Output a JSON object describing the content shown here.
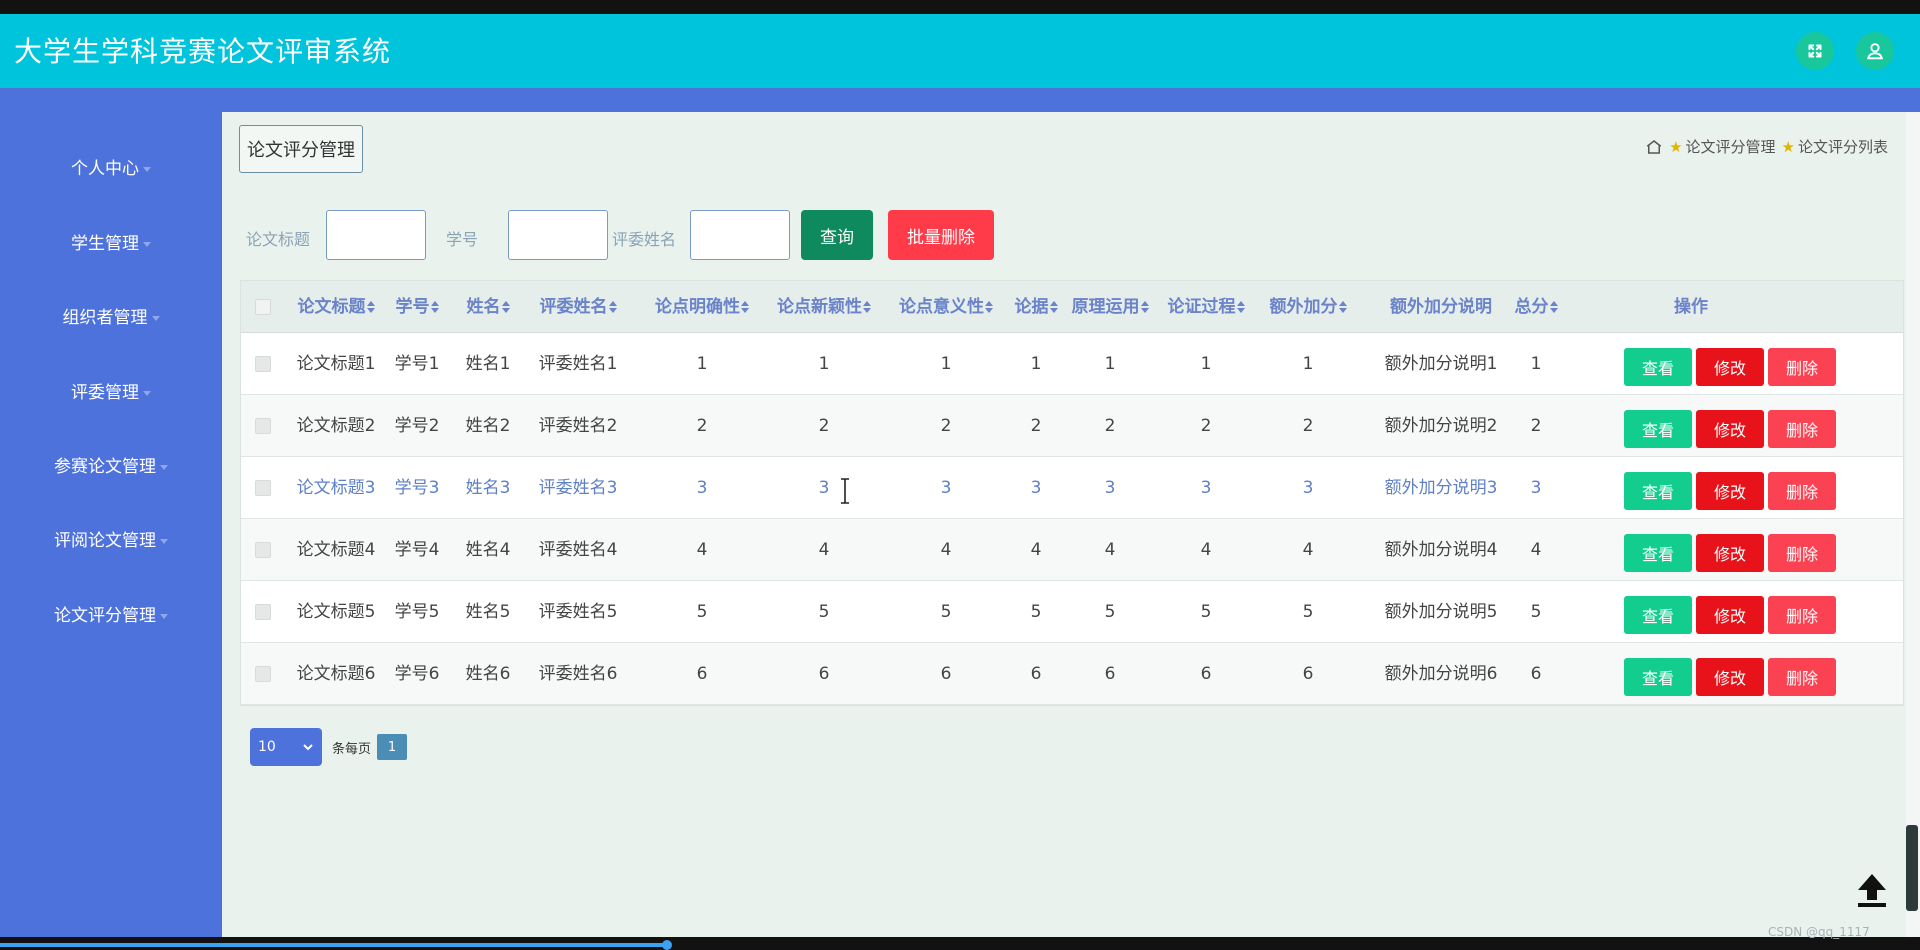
{
  "header": {
    "title": "大学生学科竞赛论文评审系统",
    "fullscreen_icon": "fullscreen-icon",
    "user_icon": "user-icon"
  },
  "sidebar": {
    "items": [
      {
        "label": "个人中心"
      },
      {
        "label": "学生管理"
      },
      {
        "label": "组织者管理"
      },
      {
        "label": "评委管理"
      },
      {
        "label": "参赛论文管理"
      },
      {
        "label": "评阅论文管理"
      },
      {
        "label": "论文评分管理"
      }
    ]
  },
  "main": {
    "section_title": "论文评分管理",
    "breadcrumb": {
      "home_icon": "home-icon",
      "item1": "论文评分管理",
      "item2": "论文评分列表"
    }
  },
  "search": {
    "label_title": "论文标题",
    "label_id": "学号",
    "label_judge": "评委姓名",
    "value_title": "",
    "value_id": "",
    "value_judge": "",
    "query_label": "查询",
    "bulk_delete_label": "批量删除"
  },
  "table": {
    "columns": {
      "title": "论文标题",
      "student_id": "学号",
      "name": "姓名",
      "judge": "评委姓名",
      "clarity": "论点明确性",
      "novelty": "论点新颖性",
      "significance": "论点意义性",
      "evidence": "论据",
      "principle": "原理运用",
      "process": "论证过程",
      "bonus": "额外加分",
      "bonus_note": "额外加分说明",
      "total": "总分",
      "actions": "操作"
    },
    "rows": [
      {
        "title": "论文标题1",
        "student_id": "学号1",
        "name": "姓名1",
        "judge": "评委姓名1",
        "clarity": "1",
        "novelty": "1",
        "significance": "1",
        "evidence": "1",
        "principle": "1",
        "process": "1",
        "bonus": "1",
        "bonus_note": "额外加分说明1",
        "total": "1"
      },
      {
        "title": "论文标题2",
        "student_id": "学号2",
        "name": "姓名2",
        "judge": "评委姓名2",
        "clarity": "2",
        "novelty": "2",
        "significance": "2",
        "evidence": "2",
        "principle": "2",
        "process": "2",
        "bonus": "2",
        "bonus_note": "额外加分说明2",
        "total": "2"
      },
      {
        "title": "论文标题3",
        "student_id": "学号3",
        "name": "姓名3",
        "judge": "评委姓名3",
        "clarity": "3",
        "novelty": "3",
        "significance": "3",
        "evidence": "3",
        "principle": "3",
        "process": "3",
        "bonus": "3",
        "bonus_note": "额外加分说明3",
        "total": "3"
      },
      {
        "title": "论文标题4",
        "student_id": "学号4",
        "name": "姓名4",
        "judge": "评委姓名4",
        "clarity": "4",
        "novelty": "4",
        "significance": "4",
        "evidence": "4",
        "principle": "4",
        "process": "4",
        "bonus": "4",
        "bonus_note": "额外加分说明4",
        "total": "4"
      },
      {
        "title": "论文标题5",
        "student_id": "学号5",
        "name": "姓名5",
        "judge": "评委姓名5",
        "clarity": "5",
        "novelty": "5",
        "significance": "5",
        "evidence": "5",
        "principle": "5",
        "process": "5",
        "bonus": "5",
        "bonus_note": "额外加分说明5",
        "total": "5"
      },
      {
        "title": "论文标题6",
        "student_id": "学号6",
        "name": "姓名6",
        "judge": "评委姓名6",
        "clarity": "6",
        "novelty": "6",
        "significance": "6",
        "evidence": "6",
        "principle": "6",
        "process": "6",
        "bonus": "6",
        "bonus_note": "额外加分说明6",
        "total": "6"
      }
    ],
    "actions": {
      "view": "查看",
      "edit": "修改",
      "delete": "删除"
    }
  },
  "pagination": {
    "page_size": "10",
    "per_page_label": "条每页",
    "current_page": "1"
  },
  "watermark": "CSDN @qq_1117",
  "colors": {
    "header": "#00c4dc",
    "sidebar": "#4e72db",
    "view": "#13cd8f",
    "edit": "#e8121b",
    "delete": "#fb4253",
    "query": "#0f8a5e",
    "bulk_delete": "#ff3b49"
  }
}
